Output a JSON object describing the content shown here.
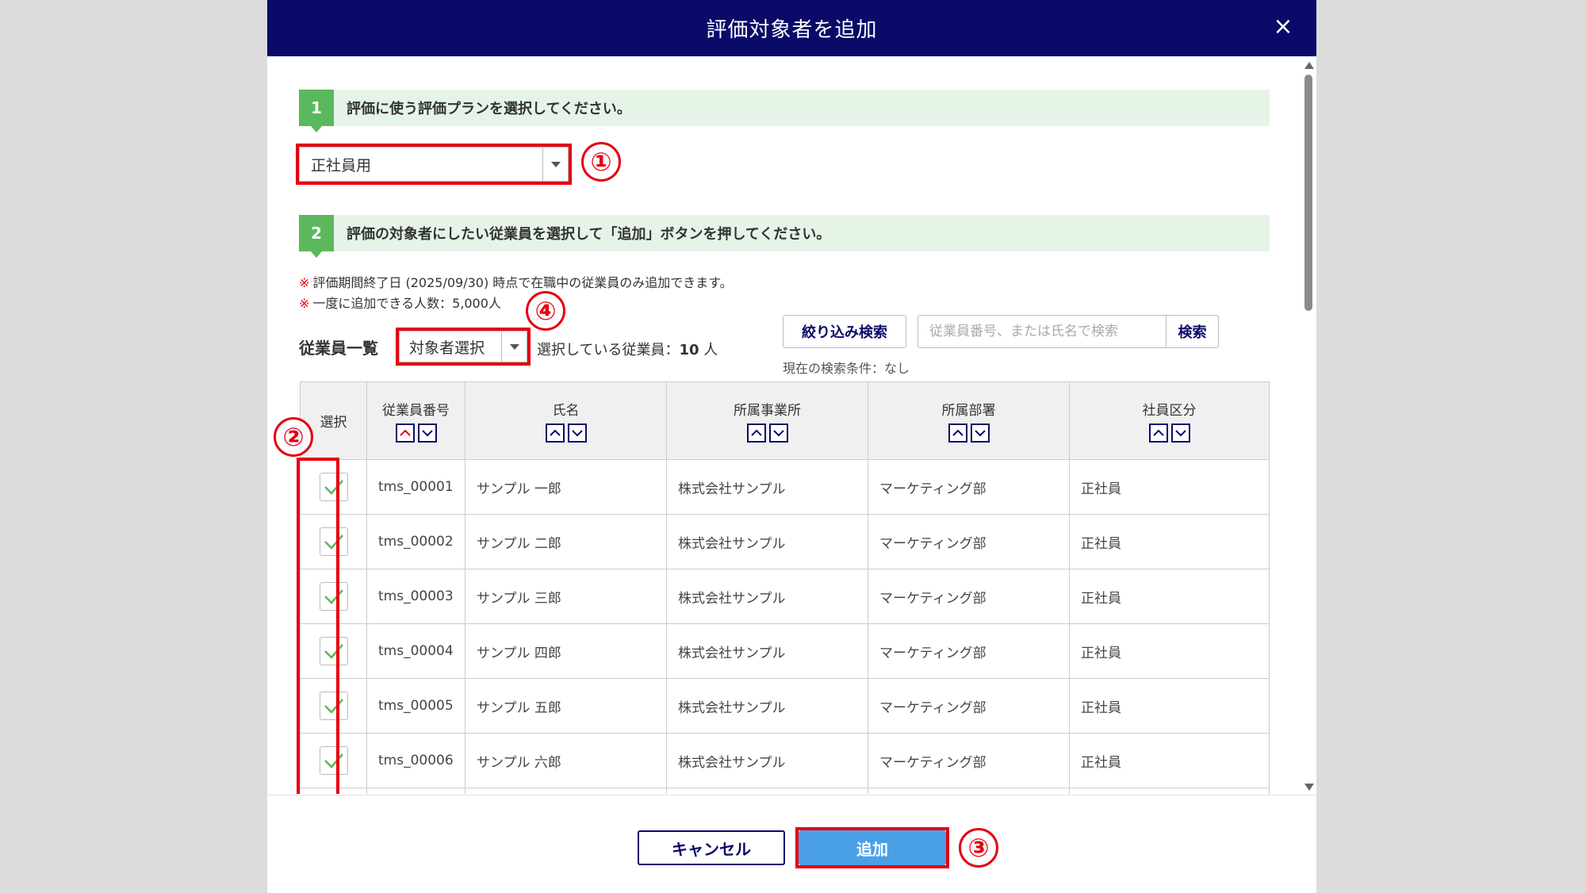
{
  "modal": {
    "title": "評価対象者を追加",
    "close_label": "×"
  },
  "step1": {
    "number": "1",
    "text": "評価に使う評価プランを選択してください。",
    "plan_selected": "正社員用"
  },
  "step2": {
    "number": "2",
    "text": "評価の対象者にしたい従業員を選択して「追加」ボタンを押してください。"
  },
  "notes": [
    {
      "mark": "※",
      "text": "評価期間終了日 (2025/09/30) 時点で在職中の従業員のみ追加できます。"
    },
    {
      "mark": "※",
      "text": "一度に追加できる人数：5,000人"
    }
  ],
  "list": {
    "label": "従業員一覧",
    "target_select_value": "対象者選択",
    "selected_prefix": "選択している従業員：",
    "selected_count": "10",
    "selected_suffix": " 人",
    "filter_button": "絞り込み検索",
    "search_placeholder": "従業員番号、または氏名で検索",
    "search_value": "",
    "search_button": "検索",
    "search_condition": "現在の検索条件：なし"
  },
  "table": {
    "headers": [
      "選択",
      "従業員番号",
      "氏名",
      "所属事業所",
      "所属部署",
      "社員区分"
    ],
    "rows": [
      {
        "checked": true,
        "id": "tms_00001",
        "name": "サンプル 一郎",
        "office": "株式会社サンプル",
        "dept": "マーケティング部",
        "type": "正社員"
      },
      {
        "checked": true,
        "id": "tms_00002",
        "name": "サンプル 二郎",
        "office": "株式会社サンプル",
        "dept": "マーケティング部",
        "type": "正社員"
      },
      {
        "checked": true,
        "id": "tms_00003",
        "name": "サンプル 三郎",
        "office": "株式会社サンプル",
        "dept": "マーケティング部",
        "type": "正社員"
      },
      {
        "checked": true,
        "id": "tms_00004",
        "name": "サンプル 四郎",
        "office": "株式会社サンプル",
        "dept": "マーケティング部",
        "type": "正社員"
      },
      {
        "checked": true,
        "id": "tms_00005",
        "name": "サンプル 五郎",
        "office": "株式会社サンプル",
        "dept": "マーケティング部",
        "type": "正社員"
      },
      {
        "checked": true,
        "id": "tms_00006",
        "name": "サンプル 六郎",
        "office": "株式会社サンプル",
        "dept": "マーケティング部",
        "type": "正社員"
      }
    ]
  },
  "footer": {
    "cancel_label": "キャンセル",
    "add_label": "追加"
  },
  "callouts": [
    "①",
    "②",
    "③",
    "④"
  ],
  "colors": {
    "header_bg": "#0a0a68",
    "step_bg": "#e6f4e8",
    "step_num": "#5cb85c",
    "highlight": "#e60012",
    "add_button": "#4aa0e6",
    "check": "#5cb85c"
  }
}
